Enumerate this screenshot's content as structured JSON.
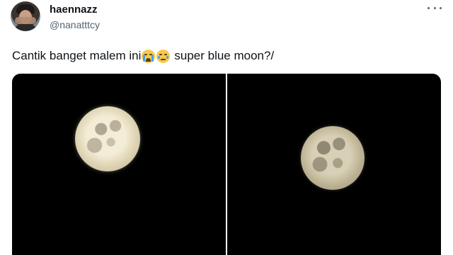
{
  "tweet": {
    "author": {
      "display_name": "haennazz",
      "handle": "@nanatttcy",
      "avatar_icon": "profile-photo"
    },
    "more_icon": "more-horizontal-icon",
    "text": {
      "part1": "Cantik banget malem ini",
      "emoji1": "loudly-crying-face",
      "emoji2": "face-holding-back-tears",
      "part2": "super blue moon?/"
    },
    "media": [
      {
        "subject": "full-moon-photo-1"
      },
      {
        "subject": "full-moon-photo-2"
      }
    ]
  },
  "colors": {
    "text_primary": "#0f1419",
    "text_secondary": "#536471",
    "media_background": "#000000"
  }
}
